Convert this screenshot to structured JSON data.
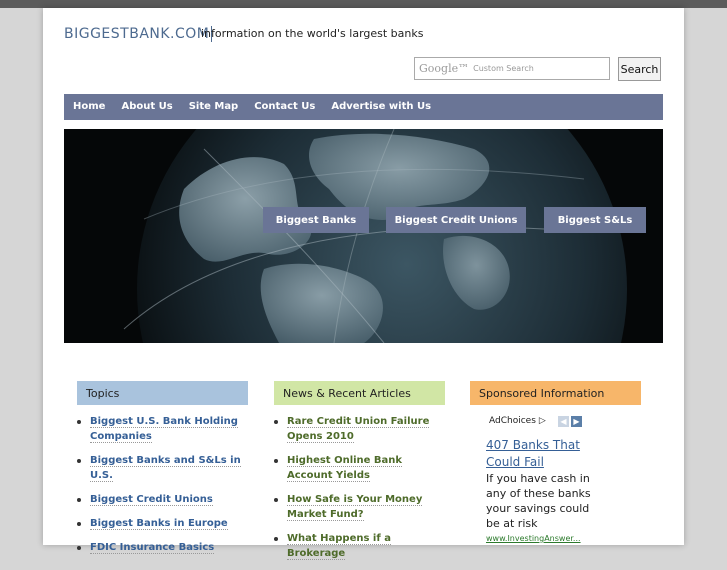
{
  "header": {
    "site_name": "BIGGESTBANK.COM",
    "tagline": "information on the world's largest banks"
  },
  "search": {
    "google_label": "Google™",
    "placeholder": "Custom Search",
    "button_label": "Search"
  },
  "nav": {
    "items": [
      {
        "label": "Home"
      },
      {
        "label": "About Us"
      },
      {
        "label": "Site Map"
      },
      {
        "label": "Contact Us"
      },
      {
        "label": "Advertise with Us"
      }
    ]
  },
  "hero": {
    "tabs": [
      {
        "label": "Biggest Banks"
      },
      {
        "label": "Biggest Credit Unions"
      },
      {
        "label": "Biggest S&Ls"
      }
    ]
  },
  "columns": {
    "topics": {
      "heading": "Topics",
      "color": "#a9c3dd",
      "items": [
        "Biggest U.S. Bank Holding Companies",
        "Biggest Banks and S&Ls in U.S.",
        "Biggest Credit Unions",
        "Biggest Banks in Europe",
        "FDIC Insurance Basics"
      ]
    },
    "news": {
      "heading": "News & Recent Articles",
      "color": "#d1e6a5",
      "items": [
        "Rare Credit Union Failure Opens 2010",
        "Highest Online Bank Account Yields",
        "How Safe is Your Money Market Fund?",
        "What Happens if a Brokerage"
      ]
    },
    "sponsored": {
      "heading": "Sponsored Information",
      "color": "#f7b66a",
      "adchoices_label": "AdChoices",
      "ad_title": "407 Banks That Could Fail",
      "ad_text": "If you have cash in any of these banks your savings could be at risk",
      "ad_url": "www.InvestingAnswer..."
    }
  }
}
